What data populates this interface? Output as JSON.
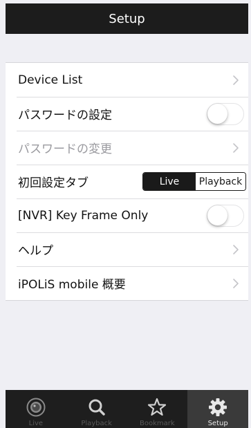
{
  "navbar": {
    "title": "Setup"
  },
  "rows": [
    {
      "label": "Device List",
      "accessory": "chevron"
    },
    {
      "label": "パスワードの設定",
      "accessory": "toggle",
      "value": false
    },
    {
      "label": "パスワードの変更",
      "accessory": "chevron",
      "disabled": true
    },
    {
      "label": "初回設定タブ",
      "accessory": "segmented",
      "options": [
        "Live",
        "Playback"
      ],
      "selected": "Live"
    },
    {
      "label": "[NVR] Key Frame Only",
      "accessory": "toggle",
      "value": false
    },
    {
      "label": "ヘルプ",
      "accessory": "chevron"
    },
    {
      "label": "iPOLiS mobile 概要",
      "accessory": "chevron"
    }
  ],
  "tabbar": {
    "items": [
      {
        "label": "Live",
        "icon": "live-icon"
      },
      {
        "label": "Playback",
        "icon": "search-icon"
      },
      {
        "label": "Bookmark",
        "icon": "star-icon"
      },
      {
        "label": "Setup",
        "icon": "gear-icon",
        "active": true
      }
    ]
  },
  "colors": {
    "bar_background": "#1c1c1c",
    "page_background": "#efeff4",
    "active_tab": "#3a3a3a"
  }
}
